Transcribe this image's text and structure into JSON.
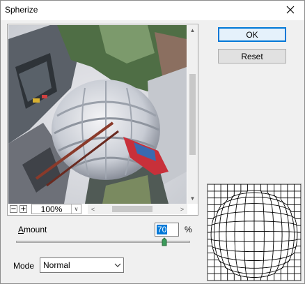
{
  "window": {
    "title": "Spherize"
  },
  "buttons": {
    "ok": "OK",
    "reset": "Reset"
  },
  "zoom": {
    "value": "100%"
  },
  "amount": {
    "label_prefix": "A",
    "label_rest": "mount",
    "value": "70",
    "unit": "%",
    "slider_level": 0.85
  },
  "mode": {
    "label": "Mode",
    "selected": "Normal"
  },
  "colors": {
    "accent": "#0078d7",
    "thumb_fill": "#3a9a5a"
  }
}
